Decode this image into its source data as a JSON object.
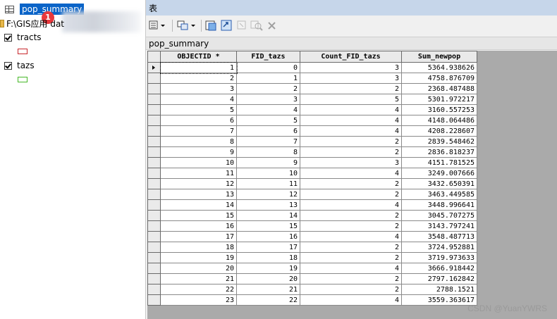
{
  "toc": {
    "selected_table": "pop_summary",
    "badge": "1",
    "folder_path": "F:\\GIS应用 dat",
    "layers": [
      {
        "label": "tracts",
        "checked": true,
        "swatch_color": "#c8282d"
      },
      {
        "label": "tazs",
        "checked": true,
        "swatch_color": "#46b828"
      }
    ]
  },
  "window": {
    "title": "表",
    "table_name": "pop_summary"
  },
  "table": {
    "columns": [
      "OBJECTID *",
      "FID_tazs",
      "Count_FID_tazs",
      "Sum_newpop"
    ],
    "rows": [
      [
        "1",
        "0",
        "3",
        "5364.938626"
      ],
      [
        "2",
        "1",
        "3",
        "4758.876709"
      ],
      [
        "3",
        "2",
        "2",
        "2368.487488"
      ],
      [
        "4",
        "3",
        "5",
        "5301.972217"
      ],
      [
        "5",
        "4",
        "4",
        "3160.557253"
      ],
      [
        "6",
        "5",
        "4",
        "4148.064486"
      ],
      [
        "7",
        "6",
        "4",
        "4208.228607"
      ],
      [
        "8",
        "7",
        "2",
        "2839.548462"
      ],
      [
        "9",
        "8",
        "2",
        "2836.818237"
      ],
      [
        "10",
        "9",
        "3",
        "4151.781525"
      ],
      [
        "11",
        "10",
        "4",
        "3249.007666"
      ],
      [
        "12",
        "11",
        "2",
        "3432.650391"
      ],
      [
        "13",
        "12",
        "2",
        "3463.449585"
      ],
      [
        "14",
        "13",
        "4",
        "3448.996641"
      ],
      [
        "15",
        "14",
        "2",
        "3045.707275"
      ],
      [
        "16",
        "15",
        "2",
        "3143.797241"
      ],
      [
        "17",
        "16",
        "4",
        "3548.487713"
      ],
      [
        "18",
        "17",
        "2",
        "3724.952881"
      ],
      [
        "19",
        "18",
        "2",
        "3719.973633"
      ],
      [
        "20",
        "19",
        "4",
        "3666.918442"
      ],
      [
        "21",
        "20",
        "2",
        "2797.162842"
      ],
      [
        "22",
        "21",
        "2",
        "2788.1521"
      ],
      [
        "23",
        "22",
        "4",
        "3559.363617"
      ]
    ]
  },
  "watermark": "CSDN @YuanYWRS"
}
